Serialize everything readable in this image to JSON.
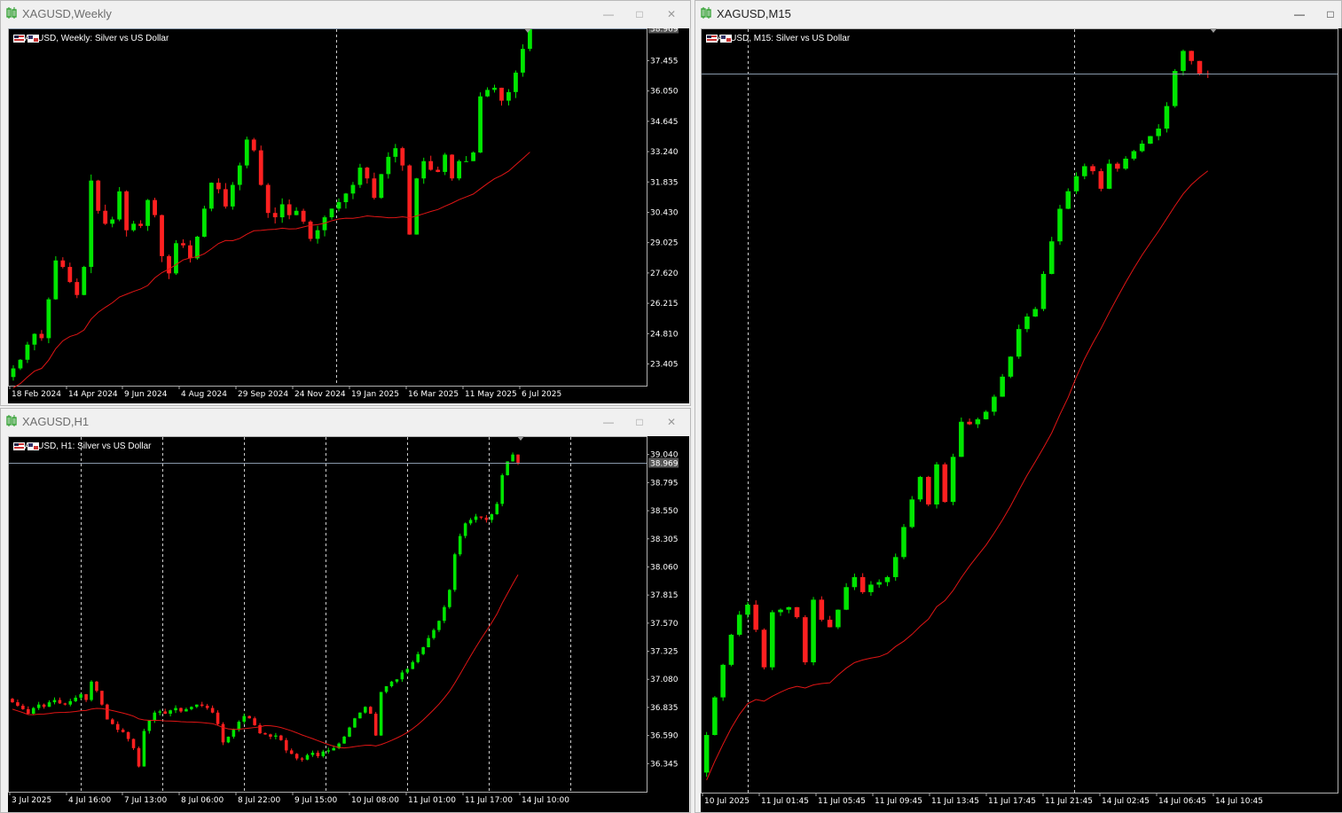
{
  "colors": {
    "bull": "#00e600",
    "bear": "#ff2020",
    "ma": "#e11515",
    "grid": "#cccccc",
    "priceLine": "#8898aa",
    "bg": "#000000"
  },
  "windows": {
    "weekly": {
      "title": "XAGUSD,Weekly",
      "chart_label": "XAGUSD, Weekly:  Silver vs US Dollar",
      "price_ticks": [
        "37.455",
        "36.050",
        "34.645",
        "33.240",
        "31.835",
        "30.430",
        "29.025",
        "27.620",
        "26.215",
        "24.810",
        "23.405"
      ],
      "current_price": "38.969",
      "time_ticks": [
        "18 Feb 2024",
        "14 Apr 2024",
        "9 Jun 2024",
        "4 Aug 2024",
        "29 Sep 2024",
        "24 Nov 2024",
        "19 Jan 2025",
        "16 Mar 2025",
        "11 May 2025",
        "6 Jul 2025"
      ],
      "icons": [
        "chart-window-icon",
        "minimize-icon",
        "maximize-icon",
        "close-icon"
      ]
    },
    "h1": {
      "title": "XAGUSD,H1",
      "chart_label": "XAGUSD, H1:  Silver vs US Dollar",
      "price_ticks": [
        "39.040",
        "38.795",
        "38.550",
        "38.305",
        "38.060",
        "37.815",
        "37.570",
        "37.325",
        "37.080",
        "36.835",
        "36.590",
        "36.345"
      ],
      "current_price": "38.969",
      "time_ticks": [
        "3 Jul 2025",
        "4 Jul 16:00",
        "7 Jul 13:00",
        "8 Jul 06:00",
        "8 Jul 22:00",
        "9 Jul 15:00",
        "10 Jul 08:00",
        "11 Jul 01:00",
        "11 Jul 17:00",
        "14 Jul 10:00"
      ]
    },
    "m15": {
      "title": "XAGUSD,M15",
      "chart_label": "XAGUSD, M15:  Silver vs US Dollar",
      "time_ticks": [
        "10 Jul 2025",
        "11 Jul 01:45",
        "11 Jul 05:45",
        "11 Jul 09:45",
        "11 Jul 13:45",
        "11 Jul 17:45",
        "11 Jul 21:45",
        "14 Jul 02:45",
        "14 Jul 06:45",
        "14 Jul 10:45"
      ]
    }
  },
  "chart_data": [
    {
      "type": "candlestick",
      "symbol": "XAGUSD",
      "timeframe": "Weekly",
      "closes": [
        23.2,
        23.6,
        24.3,
        24.8,
        24.6,
        26.4,
        28.2,
        27.9,
        27.2,
        26.6,
        27.9,
        31.9,
        30.5,
        29.9,
        30.1,
        31.4,
        29.6,
        29.9,
        29.8,
        31.0,
        30.3,
        28.4,
        27.6,
        29.0,
        28.9,
        28.3,
        29.3,
        30.6,
        31.8,
        31.5,
        30.7,
        31.7,
        32.6,
        33.8,
        33.3,
        31.7,
        30.4,
        30.2,
        30.8,
        30.3,
        30.5,
        30.0,
        29.2,
        29.6,
        30.2,
        30.6,
        30.9,
        31.3,
        31.7,
        32.5,
        32.0,
        31.1,
        32.2,
        33.0,
        33.4,
        32.6,
        29.4,
        32.0,
        32.8,
        32.4,
        32.3,
        33.1,
        32.0,
        32.8,
        32.8,
        33.2,
        35.8,
        36.1,
        36.2,
        35.6,
        36.0,
        36.9,
        38.0,
        38.969
      ],
      "ma": [
        23.3,
        23.6,
        24.0,
        24.4,
        24.8,
        25.8,
        26.8,
        27.6,
        28.2,
        28.8,
        29.4,
        29.8,
        30.1,
        30.4,
        30.6,
        30.8,
        30.9,
        31.0,
        31.1,
        31.3,
        31.7,
        32.4,
        33.5,
        34.4
      ]
    },
    {
      "type": "candlestick",
      "symbol": "XAGUSD",
      "timeframe": "H1",
      "closes": [
        36.88,
        36.85,
        36.82,
        36.78,
        36.83,
        36.86,
        36.84,
        36.88,
        36.9,
        36.87,
        36.86,
        36.89,
        36.92,
        36.95,
        36.9,
        37.06,
        36.98,
        36.86,
        36.73,
        36.69,
        36.64,
        36.62,
        36.56,
        36.48,
        36.32,
        36.63,
        36.72,
        36.79,
        36.8,
        36.78,
        36.81,
        36.83,
        36.8,
        36.82,
        36.84,
        36.86,
        36.85,
        36.83,
        36.79,
        36.69,
        36.53,
        36.58,
        36.64,
        36.71,
        36.76,
        36.74,
        36.68,
        36.61,
        36.6,
        36.58,
        36.59,
        36.55,
        36.46,
        36.43,
        36.39,
        36.38,
        36.42,
        36.44,
        36.41,
        36.45,
        36.46,
        36.48,
        36.52,
        36.58,
        36.66,
        36.74,
        36.79,
        36.84,
        36.78,
        36.59,
        36.97,
        37.02,
        37.06,
        37.08,
        37.14,
        37.17,
        37.23,
        37.3,
        37.36,
        37.44,
        37.51,
        37.59,
        37.71,
        37.86,
        38.17,
        38.33,
        38.44,
        38.47,
        38.5,
        38.49,
        38.47,
        38.52,
        38.61,
        38.86,
        38.98,
        39.04,
        38.969
      ]
    },
    {
      "type": "candlestick",
      "symbol": "XAGUSD",
      "timeframe": "M15",
      "closes": [
        36.33,
        36.48,
        36.61,
        36.73,
        36.81,
        36.85,
        36.75,
        36.6,
        36.82,
        36.83,
        36.84,
        36.8,
        36.62,
        36.87,
        36.79,
        36.76,
        36.83,
        36.92,
        36.96,
        36.9,
        36.93,
        36.94,
        36.96,
        37.04,
        37.16,
        37.27,
        37.36,
        37.25,
        37.41,
        37.26,
        37.44,
        37.58,
        37.57,
        37.59,
        37.62,
        37.68,
        37.76,
        37.84,
        37.95,
        38.0,
        38.03,
        38.17,
        38.3,
        38.43,
        38.5,
        38.56,
        38.6,
        38.58,
        38.51,
        38.61,
        38.59,
        38.63,
        38.66,
        38.69,
        38.72,
        38.75,
        38.84,
        38.98,
        39.06,
        39.02,
        38.97,
        38.969
      ]
    }
  ]
}
